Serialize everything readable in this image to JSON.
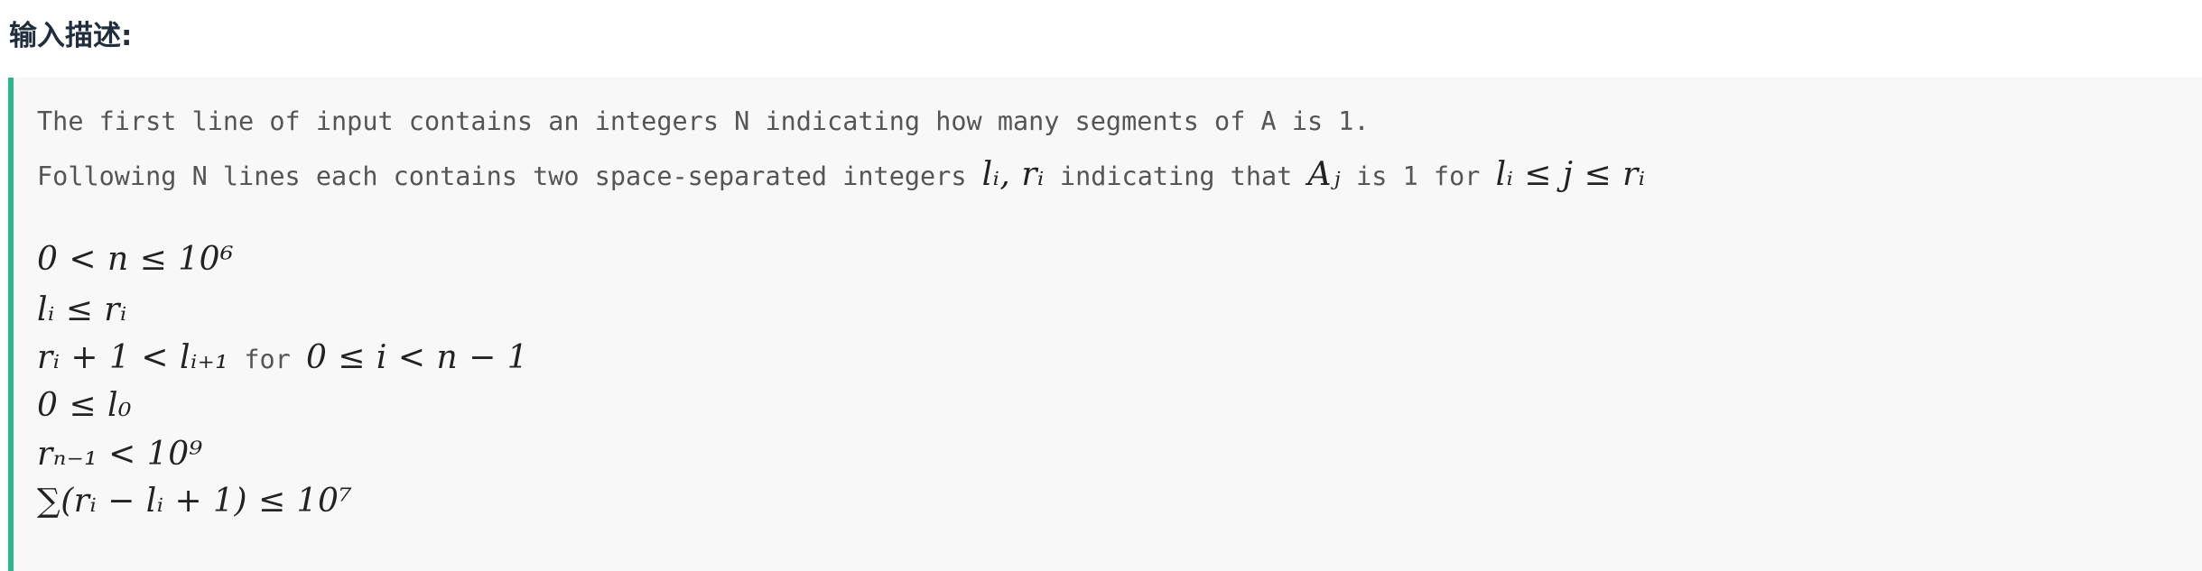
{
  "heading": "输入描述:",
  "description": {
    "line1": "The first line of input contains an integers N indicating how many segments of A is 1.",
    "line2_prefix": "Following N lines each contains two space-separated integers ",
    "line2_vars": "lᵢ, rᵢ",
    "line2_middle": " indicating that ",
    "line2_Aj": "Aⱼ",
    "line2_middle2": " is 1 for ",
    "line2_cond": "lᵢ ≤ j ≤ rᵢ"
  },
  "constraints": {
    "c1": "0 < n ≤ 10⁶",
    "c2": "lᵢ ≤ rᵢ",
    "c3_math": "rᵢ + 1 < lᵢ₊₁",
    "c3_for": " for ",
    "c3_math2": "0 ≤ i < n − 1",
    "c4": "0 ≤ l₀",
    "c5": "rₙ₋₁ < 10⁹",
    "c6": "∑(rᵢ − lᵢ + 1) ≤ 10⁷"
  },
  "colors": {
    "accent_border": "#2db68f",
    "block_bg": "#f8f8f8",
    "mono_text": "#555555",
    "heading_text": "#1f2d3d"
  }
}
